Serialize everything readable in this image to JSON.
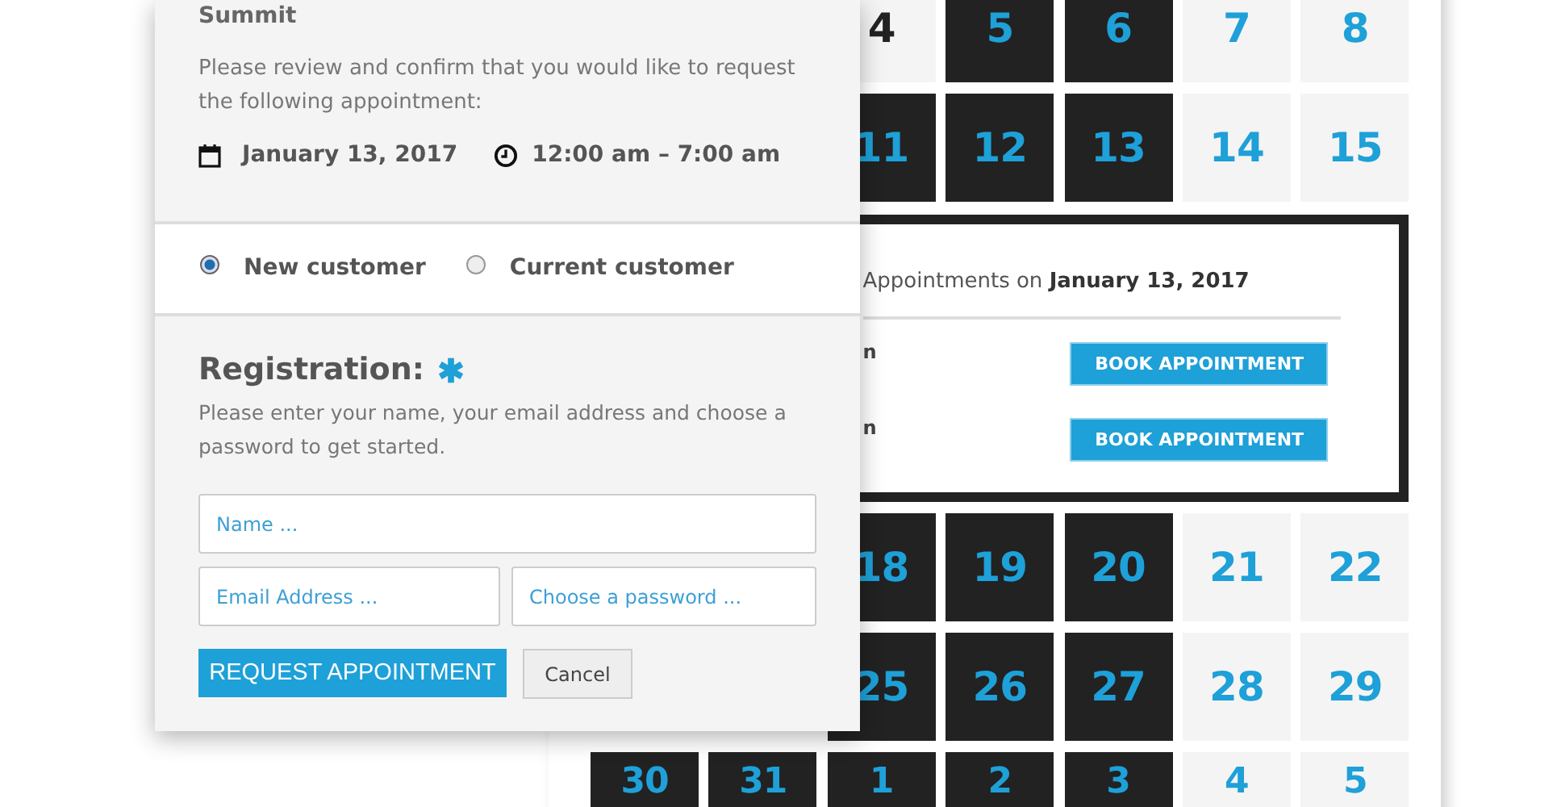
{
  "appointment_dialog": {
    "title": "Summit",
    "intro": "Please review and confirm that you would like to request the following appointment:",
    "date": "January 13, 2017",
    "time": "12:00 am – 7:00 am",
    "customer_options": [
      {
        "label": "New customer",
        "selected": true
      },
      {
        "label": "Current customer",
        "selected": false
      }
    ],
    "registration": {
      "heading": "Registration:",
      "required": true,
      "note": "Please enter your name, your email address and choose a password to get started.",
      "fields": [
        {
          "placeholder": "Name ...",
          "kind": "wide"
        },
        {
          "placeholder": "Email Address ...",
          "kind": "half"
        },
        {
          "placeholder": "Choose a password ...",
          "kind": "half"
        }
      ],
      "submit": "REQUEST APPOINTMENT",
      "cancel": "Cancel"
    }
  },
  "calendar": {
    "rows": [
      {
        "kind": "week",
        "days": [
          {
            "day": "4",
            "kind": "past"
          },
          {
            "day": "5",
            "kind": "available"
          },
          {
            "day": "6",
            "kind": "available"
          },
          {
            "day": "7",
            "kind": "unavailable"
          },
          {
            "day": "8",
            "kind": "unavailable"
          }
        ]
      },
      {
        "kind": "week",
        "days": [
          {
            "day": "11",
            "kind": "available"
          },
          {
            "day": "12",
            "kind": "available"
          },
          {
            "day": "13",
            "kind": "available"
          },
          {
            "day": "14",
            "kind": "unavailable"
          },
          {
            "day": "15",
            "kind": "unavailable"
          }
        ]
      },
      {
        "kind": "detail",
        "heading": "Appointments on",
        "date": "January 13, 2017",
        "slots": [
          {
            "time": "n",
            "button": "BOOK APPOINTMENT"
          },
          {
            "time": "n",
            "button": "BOOK APPOINTMENT"
          }
        ]
      },
      {
        "kind": "week",
        "days": [
          {
            "day": "18",
            "kind": "available"
          },
          {
            "day": "19",
            "kind": "available"
          },
          {
            "day": "20",
            "kind": "available"
          },
          {
            "day": "21",
            "kind": "unavailable"
          },
          {
            "day": "22",
            "kind": "unavailable"
          }
        ]
      },
      {
        "kind": "week",
        "days": [
          {
            "day": "25",
            "kind": "available"
          },
          {
            "day": "26",
            "kind": "available"
          },
          {
            "day": "27",
            "kind": "available"
          },
          {
            "day": "28",
            "kind": "unavailable"
          },
          {
            "day": "29",
            "kind": "unavailable"
          }
        ]
      },
      {
        "kind": "week",
        "days": [
          {
            "day": "30",
            "kind": "available"
          },
          {
            "day": "31",
            "kind": "available"
          },
          {
            "day": "1",
            "kind": "available"
          },
          {
            "day": "2",
            "kind": "available"
          },
          {
            "day": "3",
            "kind": "available"
          },
          {
            "day": "4",
            "kind": "unavailable"
          },
          {
            "day": "5",
            "kind": "unavailable"
          }
        ]
      }
    ]
  }
}
